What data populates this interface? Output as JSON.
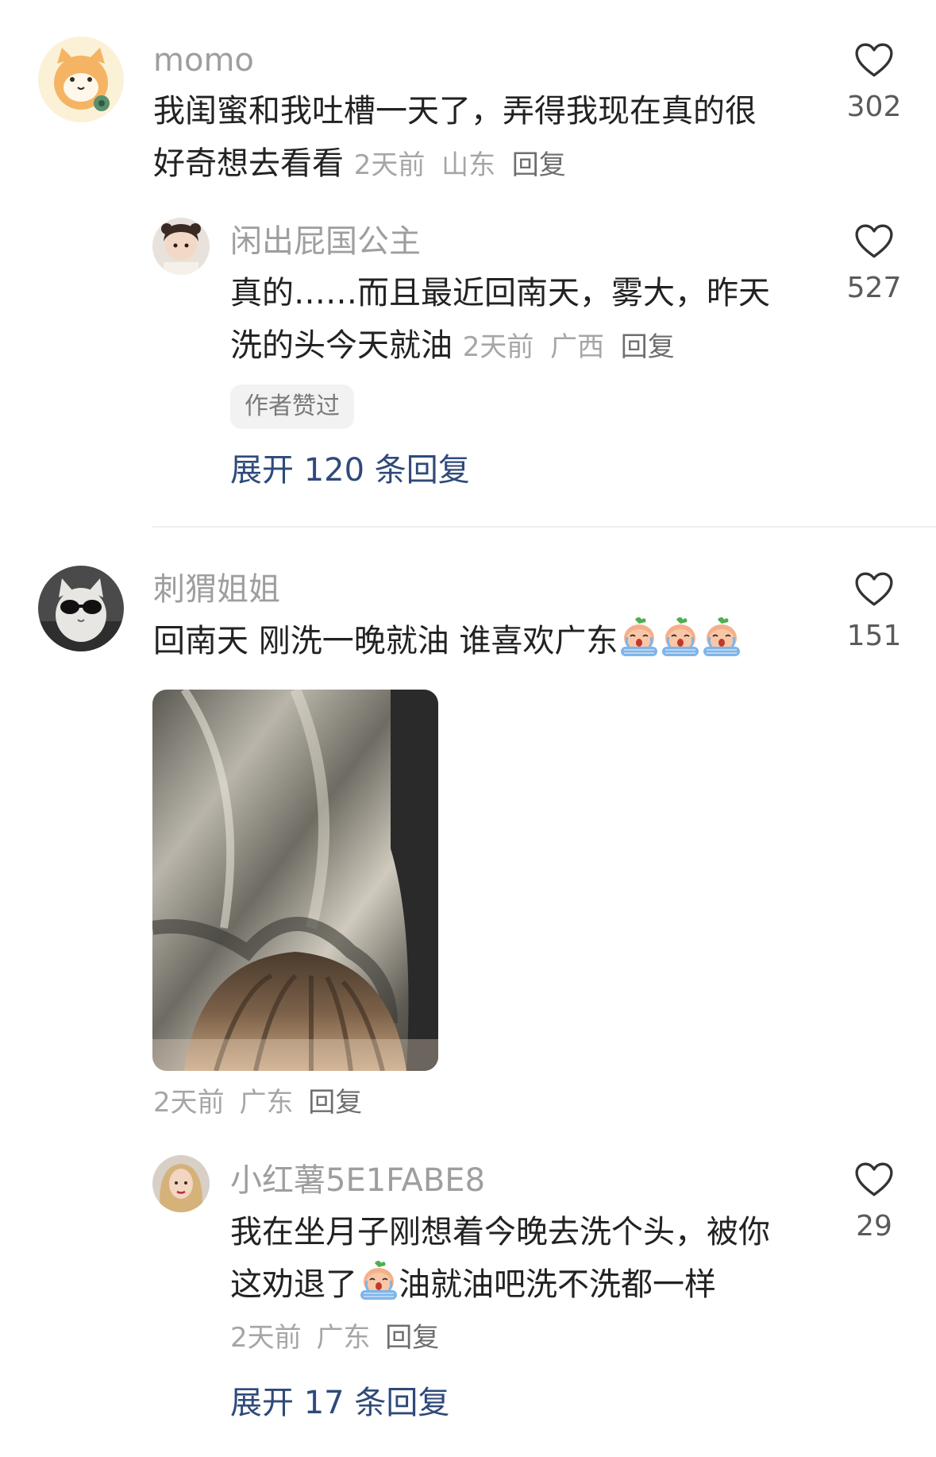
{
  "comments": [
    {
      "username": "momo",
      "text_line1": "我闺蜜和我吐槽一天了，弄得我现在真的很",
      "text_line2": "好奇想去看看",
      "time": "2天前",
      "location": "山东",
      "reply_label": "回复",
      "likes": "302",
      "avatar_icon": "cat-mascot-avatar-icon",
      "replies": [
        {
          "username": "闲出屁国公主",
          "text_line1": "真的……而且最近回南天，雾大，昨天",
          "text_line2": "洗的头今天就油",
          "time": "2天前",
          "location": "广西",
          "reply_label": "回复",
          "likes": "527",
          "badge": "作者赞过",
          "avatar_icon": "girl-avatar-icon"
        }
      ],
      "expand_label": "展开 120 条回复"
    },
    {
      "username": "刺猬姐姐",
      "text_line1": "回南天 刚洗一晚就油 谁喜欢广东",
      "emojis": [
        "crying-face-emoji",
        "crying-face-emoji",
        "crying-face-emoji"
      ],
      "time": "2天前",
      "location": "广东",
      "reply_label": "回复",
      "likes": "151",
      "avatar_icon": "cat-sunglasses-avatar-icon",
      "image_icon": "oily-hair-photo",
      "replies": [
        {
          "username": "小红薯5E1FABE8",
          "text_line1": "我在坐月子刚想着今晚去洗个头，被你",
          "text_line2_a": "这劝退了",
          "text_line2_b": "油就油吧洗不洗都一样",
          "emoji": "crying-face-emoji",
          "time": "2天前",
          "location": "广东",
          "reply_label": "回复",
          "likes": "29",
          "avatar_icon": "blonde-woman-avatar-icon"
        }
      ],
      "expand_label": "展开 17 条回复"
    }
  ],
  "colors": {
    "link": "#2f4a7a",
    "meta": "#a6a6a6",
    "text": "#222222"
  }
}
